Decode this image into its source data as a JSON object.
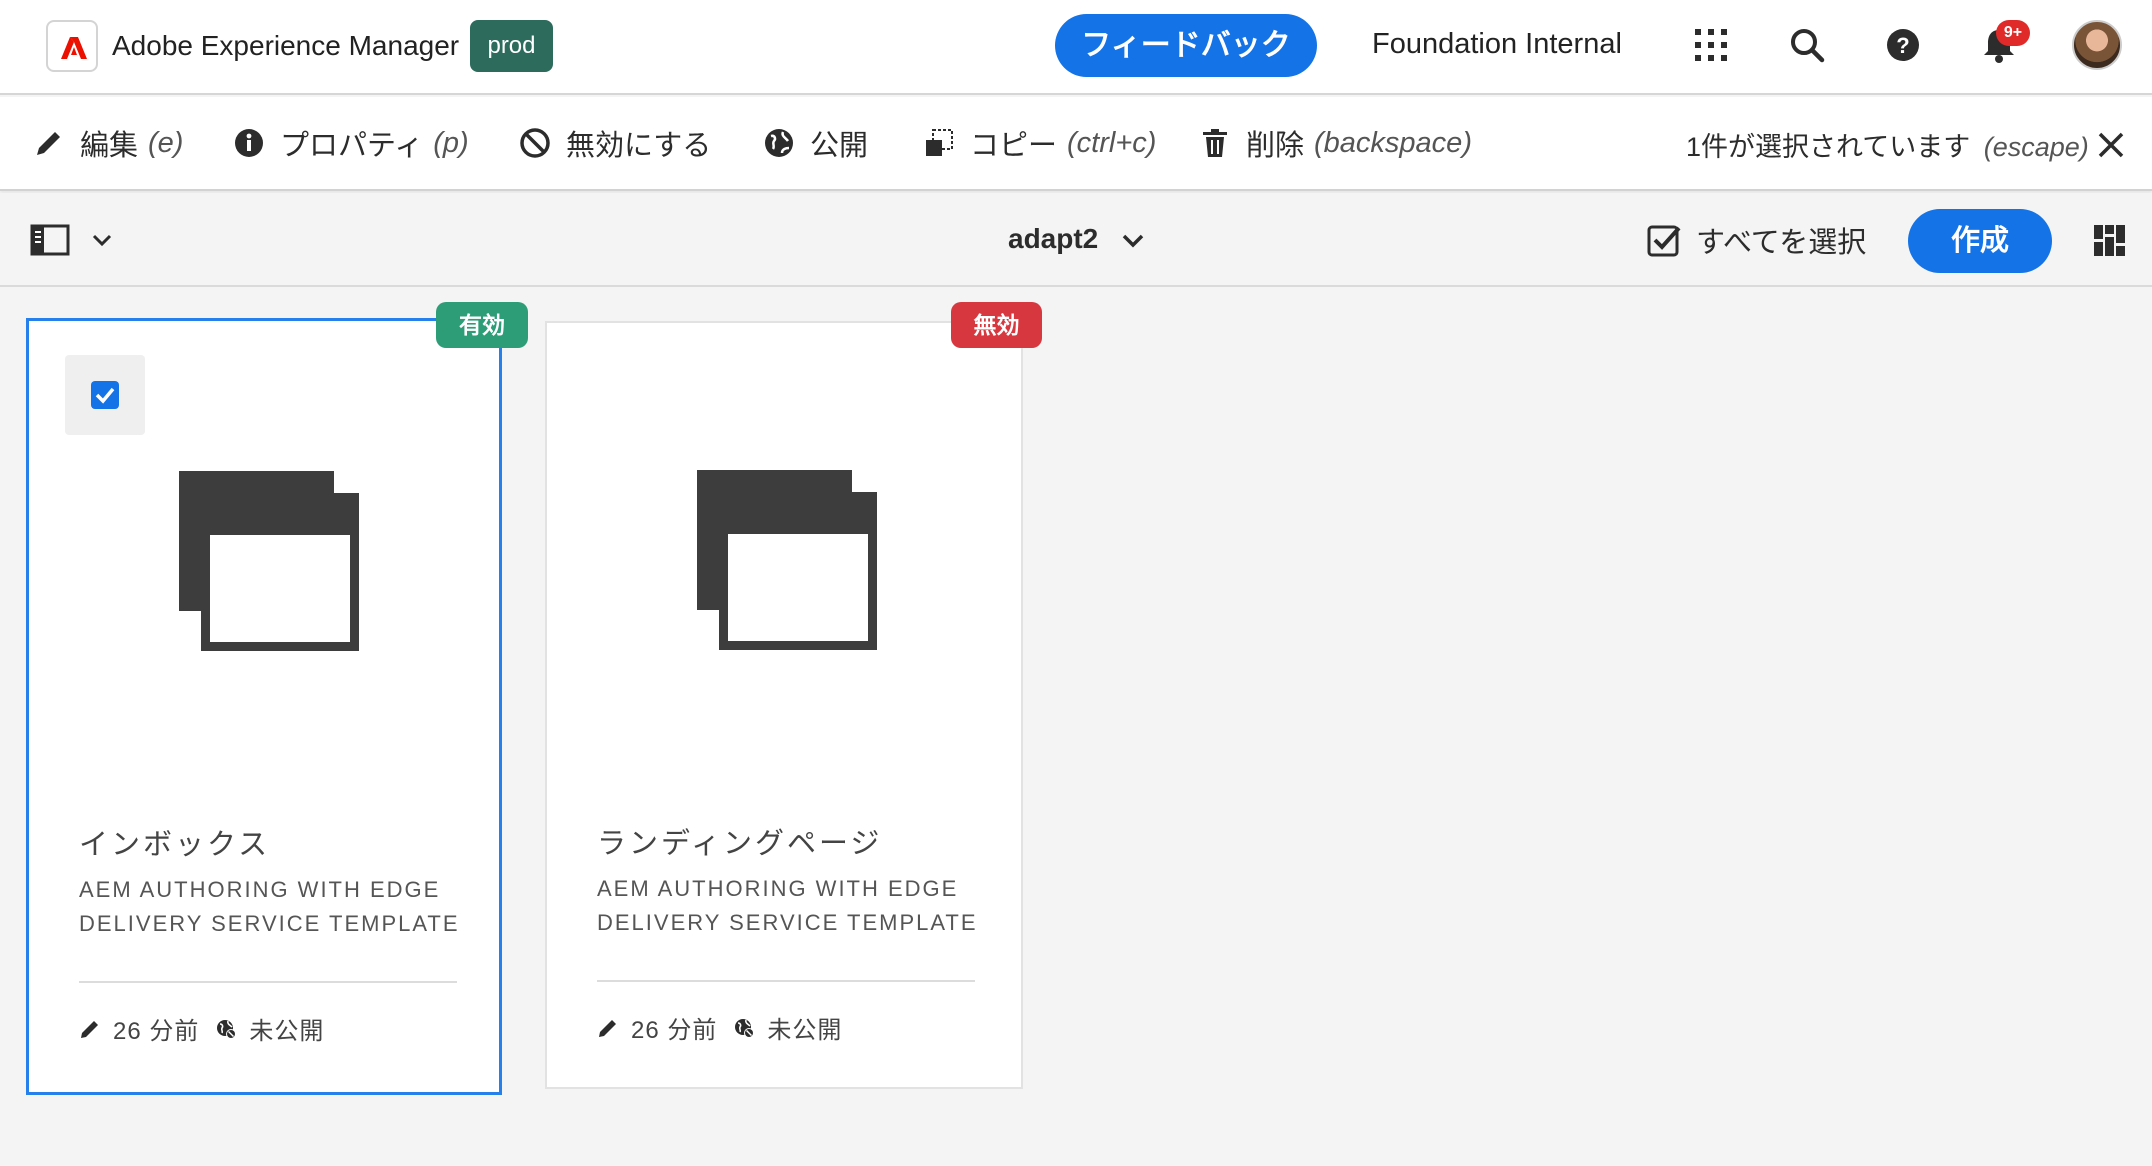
{
  "header": {
    "app_title": "Adobe Experience Manager",
    "env_badge": "prod",
    "env_badge_color": "#2d6b5d",
    "feedback_label": "フィードバック",
    "org_name": "Foundation Internal",
    "notification_count": "9+",
    "icons": [
      "adobe-logo-icon",
      "apps-grid-icon",
      "search-icon",
      "help-icon",
      "bell-icon",
      "user-avatar"
    ]
  },
  "actionbar": {
    "actions": [
      {
        "label": "編集",
        "shortcut": "(e)",
        "icon": "pencil-icon"
      },
      {
        "label": "プロパティ",
        "shortcut": "(p)",
        "icon": "info-icon"
      },
      {
        "label": "無効にする",
        "shortcut": "",
        "icon": "disable-icon"
      },
      {
        "label": "公開",
        "shortcut": "",
        "icon": "globe-icon"
      },
      {
        "label": "コピー",
        "shortcut": "(ctrl+c)",
        "icon": "copy-icon"
      },
      {
        "label": "削除",
        "shortcut": "(backspace)",
        "icon": "trash-icon"
      }
    ],
    "selection_status": "1件が選択されています",
    "selection_shortcut": "(escape)"
  },
  "subbar": {
    "folder_title": "adapt2",
    "select_all_label": "すべてを選択",
    "create_label": "作成"
  },
  "colors": {
    "accent": "#1473e6",
    "enabled": "#2d9d78",
    "disabled": "#d7373f",
    "selection_border": "#2680eb"
  },
  "cards": [
    {
      "title": "インボックス",
      "subtitle": "AEM Authoring with Edge Delivery Service Template",
      "status": "有効",
      "modified": "26 分前",
      "publish_status": "未公開",
      "selected": true
    },
    {
      "title": "ランディングページ",
      "subtitle": "AEM Authoring with Edge Delivery Service Template",
      "status": "無効",
      "modified": "26 分前",
      "publish_status": "未公開",
      "selected": false
    }
  ]
}
